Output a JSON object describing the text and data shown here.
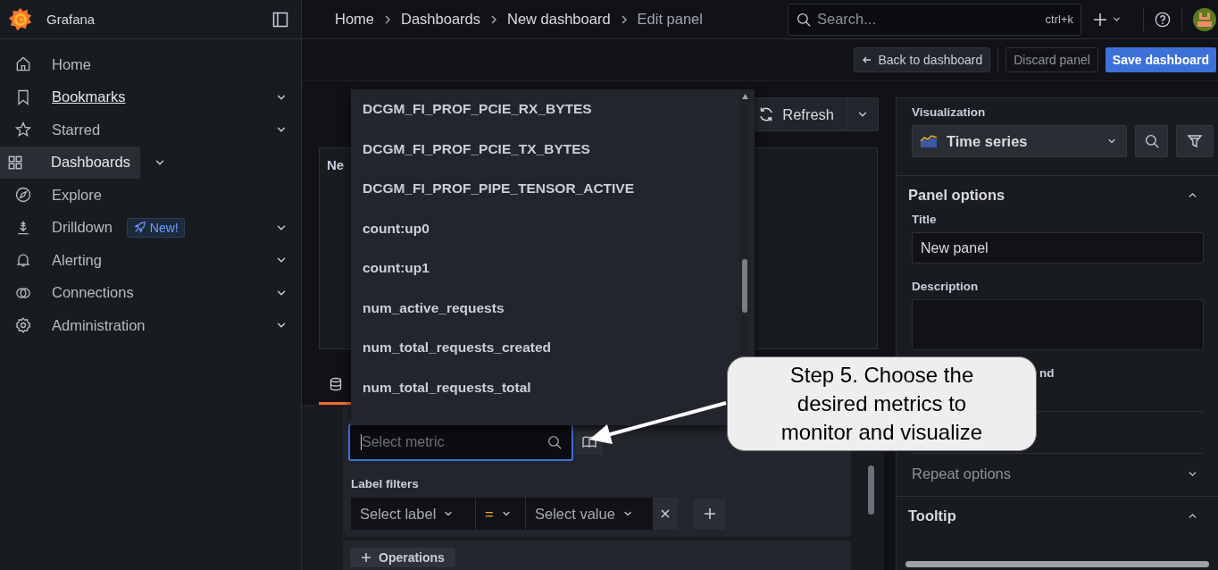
{
  "sidebar": {
    "title": "Grafana",
    "items": [
      {
        "label": "Home",
        "selected": false,
        "hovered": false,
        "expandable": false
      },
      {
        "label": "Bookmarks",
        "selected": false,
        "hovered": true,
        "expandable": true
      },
      {
        "label": "Starred",
        "selected": false,
        "hovered": false,
        "expandable": true
      },
      {
        "label": "Dashboards",
        "selected": true,
        "hovered": false,
        "expandable": true
      },
      {
        "label": "Explore",
        "selected": false,
        "hovered": false,
        "expandable": false
      },
      {
        "label": "Drilldown",
        "selected": false,
        "hovered": false,
        "expandable": true,
        "badge": "New!"
      },
      {
        "label": "Alerting",
        "selected": false,
        "hovered": false,
        "expandable": true
      },
      {
        "label": "Connections",
        "selected": false,
        "hovered": false,
        "expandable": true
      },
      {
        "label": "Administration",
        "selected": false,
        "hovered": false,
        "expandable": true
      }
    ]
  },
  "breadcrumbs": [
    "Home",
    "Dashboards",
    "New dashboard",
    "Edit panel"
  ],
  "search": {
    "placeholder": "Search...",
    "shortcut": "ctrl+k"
  },
  "toolbar": {
    "back": "Back to dashboard",
    "discard": "Discard panel",
    "save": "Save dashboard"
  },
  "preview": {
    "refresh": "Refresh",
    "panel_title": "Ne"
  },
  "query": {
    "metric_placeholder": "Select metric",
    "label_filters": "Label filters",
    "label_placeholder": "Select label",
    "operator": "=",
    "value_placeholder": "Select value",
    "operations": "Operations"
  },
  "metric_dropdown": {
    "items": [
      "DCGM_FI_PROF_PCIE_RX_BYTES",
      "DCGM_FI_PROF_PCIE_TX_BYTES",
      "DCGM_FI_PROF_PIPE_TENSOR_ACTIVE",
      "count:up0",
      "count:up1",
      "num_active_requests",
      "num_total_requests_created",
      "num_total_requests_total"
    ]
  },
  "options": {
    "visualization_label": "Visualization",
    "visualization": "Time series",
    "panel_options": {
      "title": "Panel options",
      "expanded": true
    },
    "title_label": "Title",
    "title_value": "New panel",
    "description_label": "Description",
    "partial_label": "nd",
    "repeat_options": {
      "title": "Repeat options",
      "expanded": false
    },
    "tooltip": {
      "title": "Tooltip",
      "expanded": true
    }
  },
  "callout": {
    "text": "Step 5. Choose the desired metrics to monitor and visualize"
  }
}
